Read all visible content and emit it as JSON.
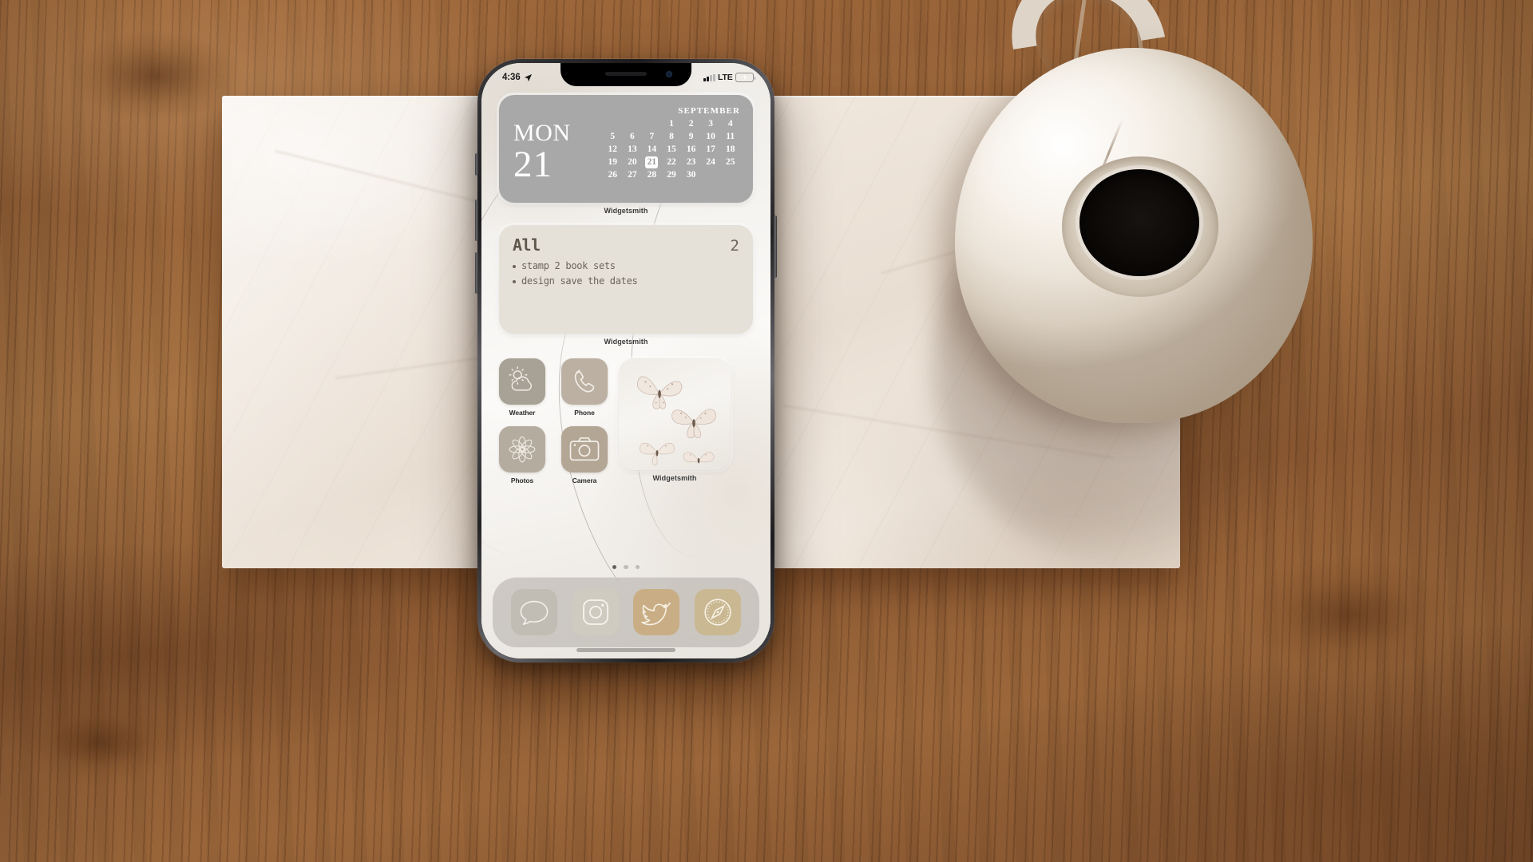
{
  "scene": {
    "description": "iPhone on marble board over wooden table with ceramic teapot",
    "background_colors": {
      "wood": "#a9703f",
      "marble": "#f2eae1",
      "ceramic": "#f0e9e0"
    }
  },
  "phone": {
    "status_bar": {
      "time": "4:36",
      "location_icon": "location-arrow-icon",
      "signal_icon": "cellular-signal-icon",
      "network": "LTE",
      "battery_icon": "battery-charging-icon",
      "battery_color": "#3ad156"
    },
    "home_screen": {
      "widgets": [
        {
          "type": "calendar",
          "app_label": "Widgetsmith",
          "background": "#a8a8a8",
          "day_of_week": "MON",
          "day_number": "21",
          "month": "SEPTEMBER",
          "today": 21,
          "leading_blanks": 3,
          "days": [
            1,
            2,
            3,
            4,
            5,
            6,
            7,
            8,
            9,
            10,
            11,
            12,
            13,
            14,
            15,
            16,
            17,
            18,
            19,
            20,
            21,
            22,
            23,
            24,
            25,
            26,
            27,
            28,
            29,
            30
          ]
        },
        {
          "type": "reminders",
          "app_label": "Widgetsmith",
          "background": "#e6e1d8",
          "title": "All",
          "count": "2",
          "items": [
            "stamp 2 book sets",
            "design save the dates"
          ]
        },
        {
          "type": "photo",
          "app_label": "Widgetsmith",
          "image": "white-butterflies-photo"
        }
      ],
      "apps": [
        {
          "name": "Weather",
          "icon": "weather-sun-cloud-icon",
          "color": "#a8a296"
        },
        {
          "name": "Phone",
          "icon": "phone-handset-icon",
          "color": "#bcb0a2"
        },
        {
          "name": "Photos",
          "icon": "photos-flower-icon",
          "color": "#b5aca0"
        },
        {
          "name": "Camera",
          "icon": "camera-icon",
          "color": "#b3a695"
        }
      ],
      "page_dots": {
        "total": 3,
        "active_index": 0
      },
      "dock": [
        {
          "name": "Messages",
          "icon": "message-bubble-icon",
          "color": "#c2bdb4"
        },
        {
          "name": "Instagram",
          "icon": "instagram-camera-icon",
          "color": "#d0cbc1"
        },
        {
          "name": "Twitter",
          "icon": "twitter-bird-icon",
          "color": "#c9ae85"
        },
        {
          "name": "Safari",
          "icon": "safari-compass-icon",
          "color": "#c9b892"
        }
      ]
    }
  }
}
